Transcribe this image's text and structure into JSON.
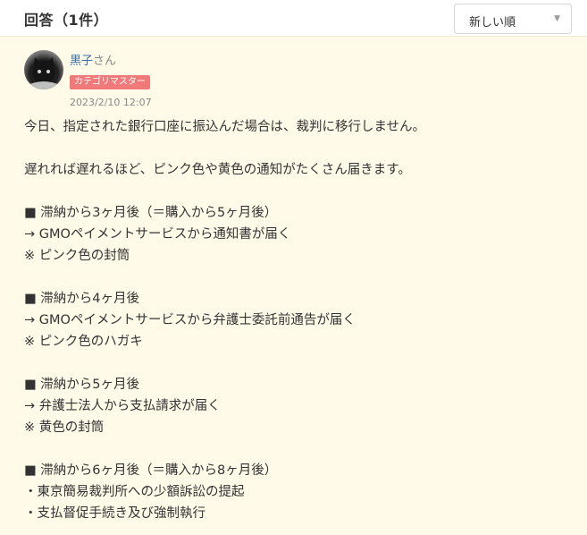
{
  "header": {
    "title": "回答（1件）",
    "sort": {
      "selected": "新しい順",
      "caret": "▼"
    }
  },
  "answer": {
    "user": {
      "name": "黒子",
      "honorific": "さん",
      "avatar": "black-cat-avatar"
    },
    "badge": "カテゴリマスター",
    "timestamp": "2023/2/10 12:07",
    "lines": [
      "今日、指定された銀行口座に振込んだ場合は、裁判に移行しません。",
      "",
      "遅れれば遅れるほど、ピンク色や黄色の通知がたくさん届きます。",
      "",
      "■ 滞納から3ヶ月後（＝購入から5ヶ月後）",
      "→ GMOペイメントサービスから通知書が届く",
      "※ ピンク色の封筒",
      "",
      "■ 滞納から4ヶ月後",
      "→ GMOペイメントサービスから弁護士委託前通告が届く",
      "※ ピンク色のハガキ",
      "",
      "■ 滞納から5ヶ月後",
      "→ 弁護士法人から支払請求が届く",
      "※ 黄色の封筒",
      "",
      "■ 滞納から6ヶ月後（＝購入から8ヶ月後）",
      "・東京簡易裁判所への少額訴訟の提起",
      "・支払督促手続き及び強制執行"
    ]
  },
  "colors": {
    "card_background": "#fffbe8",
    "badge": "#f07a7a",
    "username": "#3a6ea5"
  }
}
